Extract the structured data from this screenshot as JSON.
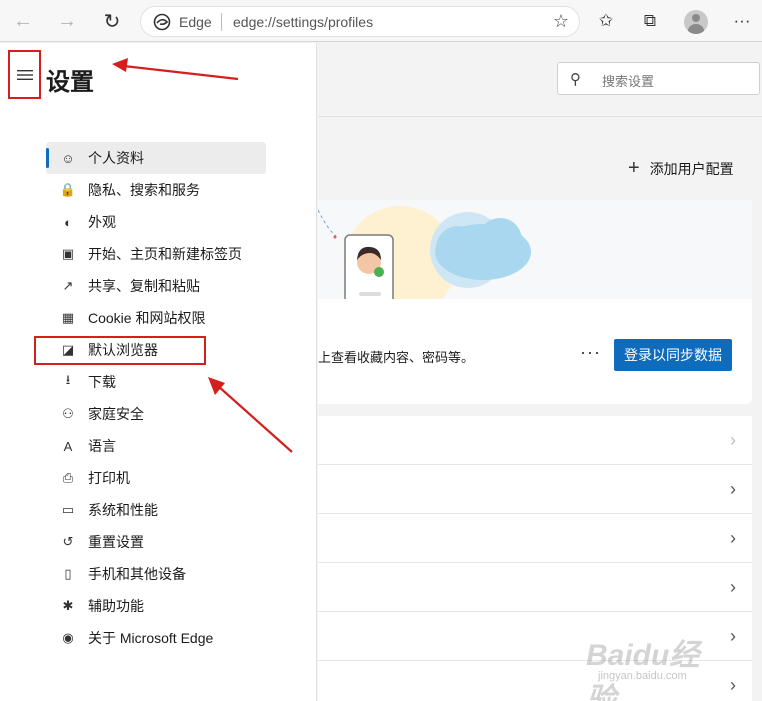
{
  "browser": {
    "address_label": "Edge",
    "url": "edge://settings/profiles"
  },
  "sidebar": {
    "title": "设置",
    "items": [
      {
        "label": "个人资料",
        "icon": "profile-icon",
        "glyph": "☺"
      },
      {
        "label": "隐私、搜索和服务",
        "icon": "lock-icon",
        "glyph": "🔒"
      },
      {
        "label": "外观",
        "icon": "palette-icon",
        "glyph": "◐"
      },
      {
        "label": "开始、主页和新建标签页",
        "icon": "home-tab-icon",
        "glyph": "▣"
      },
      {
        "label": "共享、复制和粘贴",
        "icon": "share-icon",
        "glyph": "↗"
      },
      {
        "label": "Cookie 和网站权限",
        "icon": "site-permissions-icon",
        "glyph": "▦"
      },
      {
        "label": "默认浏览器",
        "icon": "default-browser-icon",
        "glyph": "◪"
      },
      {
        "label": "下载",
        "icon": "download-icon",
        "glyph": "⭳"
      },
      {
        "label": "家庭安全",
        "icon": "family-icon",
        "glyph": "⚇"
      },
      {
        "label": "语言",
        "icon": "language-icon",
        "glyph": "A"
      },
      {
        "label": "打印机",
        "icon": "printer-icon",
        "glyph": "⎙"
      },
      {
        "label": "系统和性能",
        "icon": "laptop-icon",
        "glyph": "▭"
      },
      {
        "label": "重置设置",
        "icon": "reset-icon",
        "glyph": "↺"
      },
      {
        "label": "手机和其他设备",
        "icon": "phone-icon",
        "glyph": "▯"
      },
      {
        "label": "辅助功能",
        "icon": "accessibility-icon",
        "glyph": "✱"
      },
      {
        "label": "关于 Microsoft Edge",
        "icon": "edge-logo-icon",
        "glyph": "◉"
      }
    ]
  },
  "main": {
    "search_placeholder": "搜索设置",
    "add_profile": "添加用户配置",
    "sync_text": "上查看收藏内容、密码等。",
    "more": "···",
    "sync_button": "登录以同步数据"
  },
  "watermark": {
    "main": "Baidu经验",
    "sub": "jingyan.baidu.com"
  },
  "colors": {
    "accent": "#0f6cbd",
    "annotation": "#d51f1f"
  }
}
